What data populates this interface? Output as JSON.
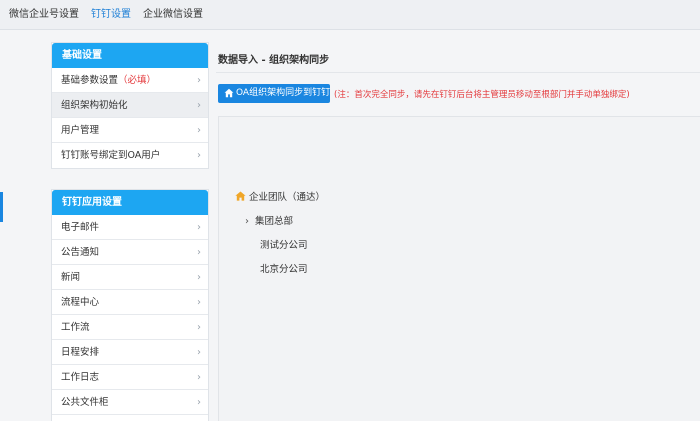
{
  "topbar": {
    "tabs": [
      {
        "label": "微信企业号设置"
      },
      {
        "label": "钉钉设置"
      },
      {
        "label": "企业微信设置"
      }
    ],
    "active_color": "#1d7fd6"
  },
  "sidebar": {
    "basic": {
      "title": "基础设置",
      "items": [
        {
          "label": "基础参数设置",
          "suffix": "（必填）"
        },
        {
          "label": "组织架构初始化"
        },
        {
          "label": "用户管理"
        },
        {
          "label": "钉钉账号绑定到OA用户"
        }
      ]
    },
    "apps": {
      "title": "钉钉应用设置",
      "items": [
        {
          "label": "电子邮件"
        },
        {
          "label": "公告通知"
        },
        {
          "label": "新闻"
        },
        {
          "label": "流程中心"
        },
        {
          "label": "工作流"
        },
        {
          "label": "日程安排"
        },
        {
          "label": "工作日志"
        },
        {
          "label": "公共文件柜"
        }
      ]
    },
    "header_color": "#1da6f2",
    "chevron": "›"
  },
  "main": {
    "title": "数据导入 - 组织架构同步",
    "sync_button": "OA组织架构同步到钉钉",
    "note": "(注：首次完全同步，请先在钉钉后台将主管理员移动至根部门并手动单独绑定)",
    "tree": {
      "root": "企业团队（通达）",
      "children": [
        {
          "label": "集团总部",
          "expandable": true
        },
        {
          "label": "测试分公司"
        },
        {
          "label": "北京分公司"
        }
      ]
    },
    "button_color": "#1a86e0",
    "note_color": "#e4393c"
  }
}
